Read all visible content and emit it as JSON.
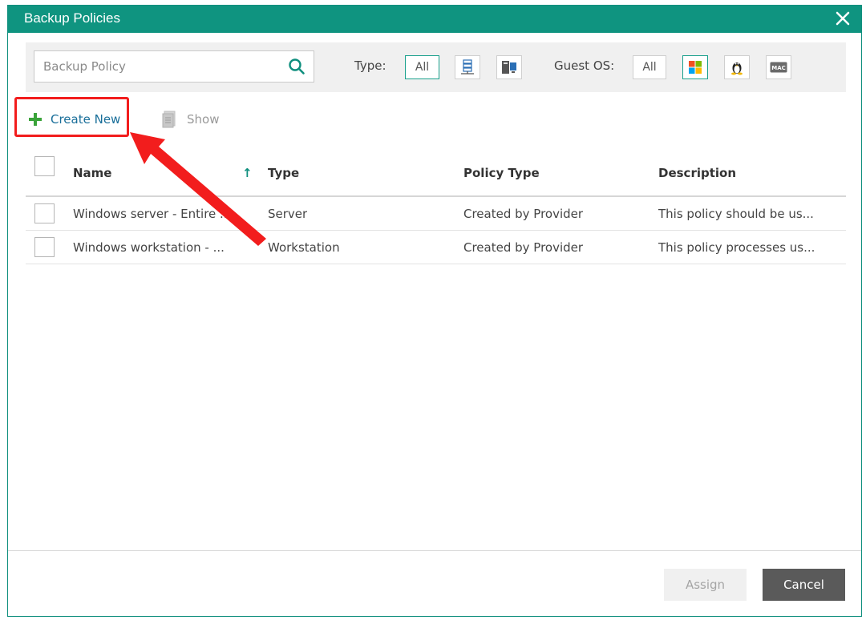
{
  "dialog": {
    "title": "Backup Policies"
  },
  "filter": {
    "search_placeholder": "Backup Policy",
    "type_label": "Type:",
    "type_all": "All",
    "guest_os_label": "Guest OS:",
    "os_all": "All",
    "os_mac_label": "MAC"
  },
  "toolbar": {
    "create_new": "Create New",
    "show": "Show"
  },
  "table": {
    "headers": {
      "name": "Name",
      "type": "Type",
      "policy_type": "Policy Type",
      "description": "Description"
    },
    "sort_indicator": "↑",
    "rows": [
      {
        "name": "Windows server - Entire ...",
        "type": "Server",
        "policy_type": "Created by Provider",
        "description": "This policy should be us..."
      },
      {
        "name": "Windows workstation - ...",
        "type": "Workstation",
        "policy_type": "Created by Provider",
        "description": "This policy processes us..."
      }
    ]
  },
  "footer": {
    "assign": "Assign",
    "cancel": "Cancel"
  },
  "colors": {
    "accent": "#0f9480",
    "annotation": "#f21d1d",
    "create_plus": "#3aa33a"
  },
  "icons": [
    "close-icon",
    "search-icon",
    "server-type-icon",
    "workstation-type-icon",
    "windows-os-icon",
    "linux-os-icon",
    "mac-os-icon",
    "plus-icon",
    "show-document-icon",
    "sort-up-arrow-icon"
  ]
}
